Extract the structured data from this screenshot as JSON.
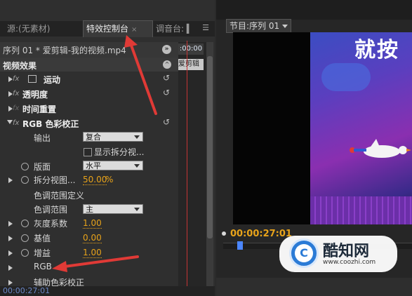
{
  "tabs": {
    "source": "源:(无素材)",
    "effect_controls": "特效控制台",
    "audio_mixer": "调音台: ▍",
    "close_glyph": "×",
    "menu_glyph": "☰"
  },
  "sequence": {
    "label": "序列 01 * 爱剪辑-我的视频.mp4",
    "nav_glyph": "»"
  },
  "effects_header": {
    "label": "视频效果",
    "collapse_glyph": "^"
  },
  "effects": [
    {
      "name": "运动"
    },
    {
      "name": "透明度"
    },
    {
      "name": "时间重置"
    },
    {
      "name": "RGB 色彩校正"
    }
  ],
  "rgb_params": {
    "output_label": "输出",
    "output_value": "复合",
    "split_view_label": "显示拆分视...",
    "layout_label": "版面",
    "layout_value": "水平",
    "split_percent_label": "拆分视图...",
    "split_percent_value": "50.00",
    "split_percent_unit": "%",
    "tonal_range_def_label": "色调范围定义",
    "tonal_range_label": "色调范围",
    "tonal_range_value": "主",
    "gamma_label": "灰度系数",
    "gamma_value": "1.00",
    "pedestal_label": "基值",
    "pedestal_value": "0.00",
    "gain_label": "增益",
    "gain_value": "1.00",
    "rgb_label": "RGB",
    "secondary_label": "辅助色彩校正"
  },
  "mini_timeline": {
    "time": ":00:00",
    "clip_label": "爱剪辑"
  },
  "left_bottom_time": "00:00:27:01",
  "reset_glyph": "↺",
  "program": {
    "tab_label": "节目:序列 01",
    "timecode": "00:00:27:01",
    "video_title": "就按"
  },
  "watermark": {
    "logo_letter": "C",
    "name": "酷知网",
    "url": "www.coozhi.com"
  },
  "colors": {
    "value_orange": "#e8a31a",
    "annotation_red": "#e03a36",
    "playhead_red": "#c53434",
    "scrubber_blue": "#4b86ff"
  }
}
